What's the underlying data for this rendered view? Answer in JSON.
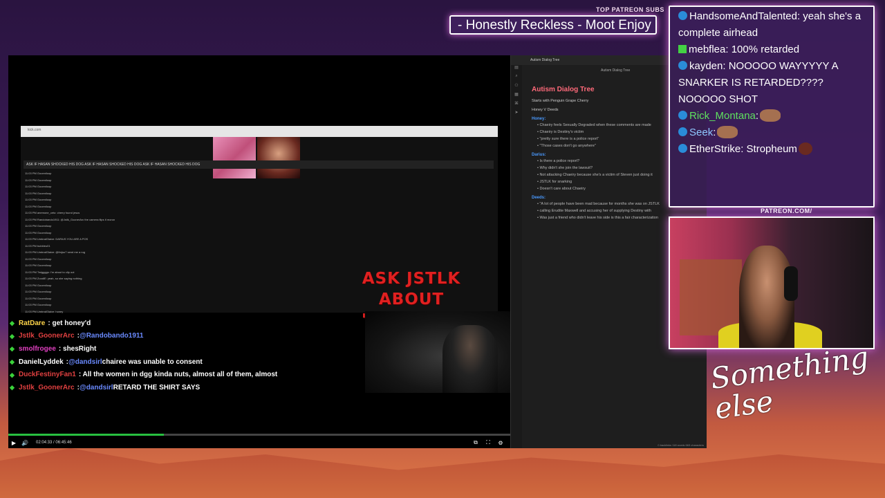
{
  "patreon": {
    "label": "TOP PATREON SUBS",
    "ticker": "- Honestly Reckless - Moot Enjoy"
  },
  "player": {
    "browser": {
      "url": "kick.com",
      "banner": "ASK IF HASAN SHOCKED HIS DOG  ASK IF HASAN SHOCKED HIS DOG  ASK IF HASAN SHOCKED HIS DOG",
      "rows": [
        "11:03 PM  Gooeniloop",
        "11:03 PM  Gooeniloop",
        "11:03 PM  Gooeniloop",
        "11:03 PM  Gooeniloop",
        "11:03 PM  Gooeniloop",
        "11:03 PM  Gooeniloop",
        "11:03 PM  anemone_ceto: cherry found jesus",
        "11:03 PM  Randobando1911: @Jstlk_GoonerArc the camera flips it moron",
        "11:03 PM  Gooeniloop",
        "11:03 PM  Gooeniloop",
        "11:03 PM  UmbralGlaive: DARIUS YOU ARE A POS",
        "11:03 PM  bubbleu01",
        "11:03 PM  UmbralGlaive: @frnjsu7 send me a rug",
        "11:03 PM  Gooeniloop",
        "11:03 PM  Gooeniloop",
        "11:03 PM  Twiggggs: I'm about to clip out",
        "11:03 PM  ZoodlE: yeah, so she saying nothing",
        "11:03 PM  Gooeniloop",
        "11:03 PM  Gooeniloop",
        "11:03 PM  Gooeniloop",
        "11:03 PM  Gooeniloop",
        "11:03 PM  UmbralGlaive: honey"
      ]
    },
    "overlay_text": "ASK JSTLK ABOUT \"CHAIERY\"",
    "chat": [
      {
        "name": "RatDare",
        "name_color": "#ffd54a",
        "msg": ": get honey'd"
      },
      {
        "name": "Jstlk_GoonerArc",
        "name_color": "#e04040",
        "mention": "@Randobando1911",
        "msg": ""
      },
      {
        "name": "smolfrogee",
        "name_color": "#e040c0",
        "msg": ": shesRight"
      },
      {
        "name": "DanielLyddek",
        "name_color": "#ffffff",
        "mention": "@dandsirl",
        "msg": "chairee was unable to consent"
      },
      {
        "name": "DuckFestinyFan1",
        "name_color": "#e04040",
        "msg": ": All the women in dgg kinda nuts, almost all of them, almost"
      },
      {
        "name": "Jstlk_GoonerArc",
        "name_color": "#e04040",
        "mention": "@dandsirl",
        "msg": "RETARD THE SHIRT SAYS"
      }
    ],
    "progress": 0.31,
    "time": "02:04:33 / 06:45:46",
    "controls": {
      "play": "▶",
      "volume": "🔊",
      "right_icons": [
        "⧉",
        "⛶",
        "⚙"
      ]
    }
  },
  "notes": {
    "tab_title": "Autism Dialog Tree",
    "subtitle": "Autism Dialog Tree",
    "title": "Autism Dialog Tree",
    "intro1": "Starts with Penguin Grape Cherry",
    "intro2": "Honey V Deeds",
    "sections": [
      {
        "heading": "Honey:",
        "bullets": [
          "Chaeiry feels Sexually Degraded when these comments are made",
          "Chaeiry is Destiny's victim",
          "\"pretty sure there is a police report\"",
          "\"Those cases don't go anywhere\""
        ]
      },
      {
        "heading": "Darius:",
        "bullets": [
          "Is there a police report?",
          "Why didn't she join the lawsuit?",
          "Not attacking Chaeiry because she's a victim of Steven just doing it",
          "JSTLK for snarking",
          "Doesn't care about Chaeiry"
        ]
      },
      {
        "heading": "Deeds:",
        "bullets": [
          "\"A lot of people have been mad because for months she was on JSTLK",
          "calling Erudite Maxwell and accusing her of supplying Destiny with",
          "Was just a friend who didn't leave his side is this a fair characterization"
        ]
      }
    ],
    "status": "0 backlinks  118 words  663 characters"
  },
  "chat_panel": {
    "rows": [
      {
        "name": "HandsomeAndTalented",
        "name_class": "",
        "icon": "ic",
        "msg": ": yeah she's a complete airhead"
      },
      {
        "name": "mebflea",
        "name_class": "",
        "icon": "kick",
        "msg": ": 100% retarded"
      },
      {
        "name": "kayden",
        "name_class": "",
        "icon": "ic",
        "msg": ": NOOOOO WAYYYYY A SNARKER IS RETARDED???? NOOOOO SHOT"
      },
      {
        "name": "Rick_Montana",
        "name_class": "name-green",
        "icon": "ic",
        "msg": ":"
      },
      {
        "name": "Seek",
        "name_class": "name-blue",
        "icon": "ic",
        "msg": ":"
      },
      {
        "name": "EtherStrike",
        "name_class": "",
        "icon": "ic",
        "msg": ": Stropheum"
      }
    ]
  },
  "webcam": {
    "label": "PATREON.COM/"
  },
  "logo": {
    "text": "Something else"
  }
}
